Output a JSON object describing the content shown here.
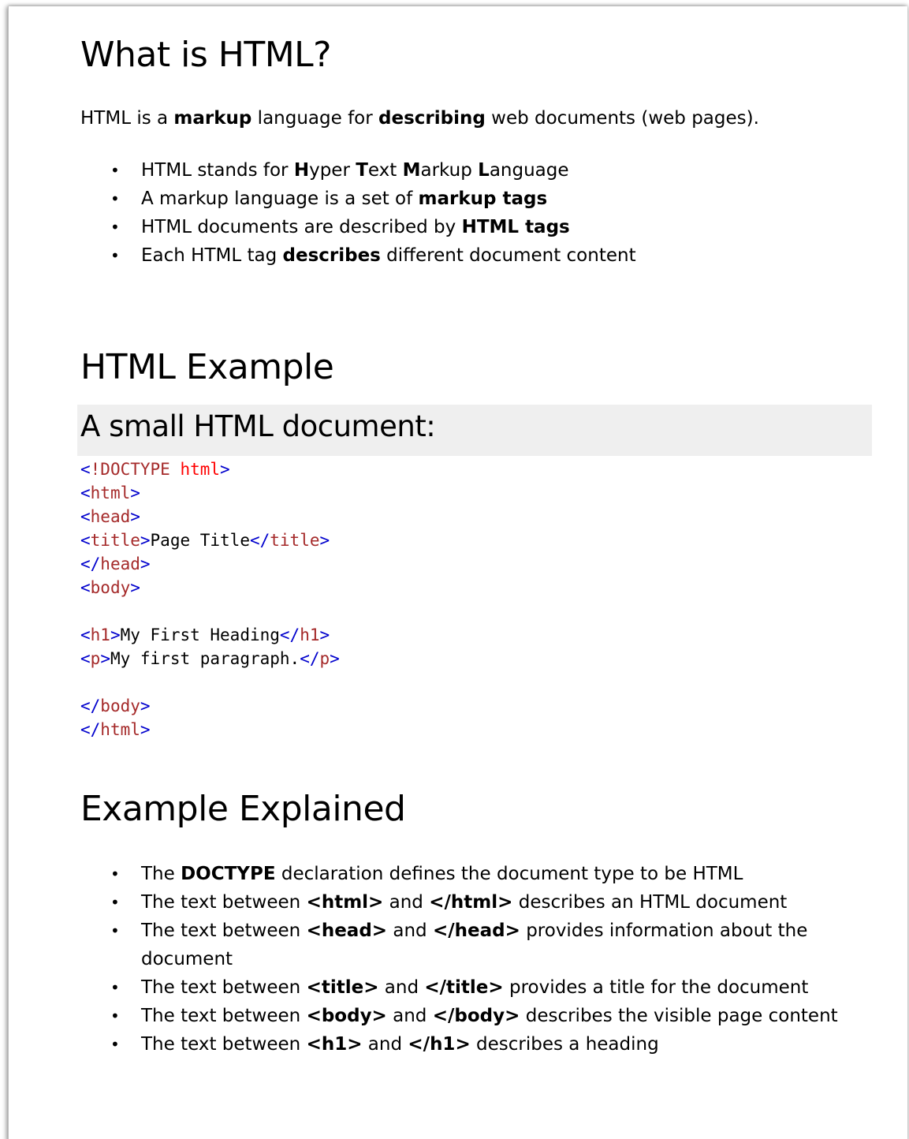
{
  "headings": {
    "what_is_html": "What is HTML?",
    "html_example": "HTML Example",
    "small_document": "A small HTML document:",
    "example_explained": "Example Explained"
  },
  "intro": {
    "p1": "HTML is a ",
    "b1": "markup",
    "p2": " language for ",
    "b2": "describing",
    "p3": " web documents (web pages)."
  },
  "what_list": [
    {
      "t1": "HTML stands for ",
      "b1": "H",
      "t2": "yper ",
      "b2": "T",
      "t3": "ext ",
      "b3": "M",
      "t4": "arkup ",
      "b4": "L",
      "t5": "anguage"
    },
    {
      "t1": "A markup language is a set of ",
      "b1": "markup tags"
    },
    {
      "t1": "HTML documents are described by ",
      "b1": "HTML tags"
    },
    {
      "t1": "Each HTML tag ",
      "b1": "describes",
      "t2": " different document content"
    }
  ],
  "code": {
    "doctype_open": "<",
    "doctype_kw": "!DOCTYPE",
    "doctype_attr": " html",
    "gt": ">",
    "lt": "<",
    "lt_slash": "</",
    "tag_html": "html",
    "tag_head": "head",
    "tag_title": "title",
    "tag_body": "body",
    "tag_h1": "h1",
    "tag_p": "p",
    "title_text": "Page Title",
    "h1_text": "My First Heading",
    "p_text": "My first paragraph."
  },
  "explained_list": [
    {
      "t1": "The ",
      "b1": "DOCTYPE",
      "t2": " declaration defines the document type to be HTML"
    },
    {
      "t1": "The text between ",
      "b1": "<html>",
      "t2": " and ",
      "b2": "</html>",
      "t3": " describes an HTML document"
    },
    {
      "t1": "The text between ",
      "b1": "<head>",
      "t2": " and ",
      "b2": "</head>",
      "t3": " provides information about the document"
    },
    {
      "t1": "The text between ",
      "b1": "<title>",
      "t2": " and ",
      "b2": "</title>",
      "t3": " provides a title for the document"
    },
    {
      "t1": "The text between ",
      "b1": "<body>",
      "t2": " and ",
      "b2": "</body>",
      "t3": " describes the visible page content"
    },
    {
      "t1": "The text between ",
      "b1": "<h1>",
      "t2": " and ",
      "b2": "</h1>",
      "t3": " describes a heading"
    }
  ]
}
